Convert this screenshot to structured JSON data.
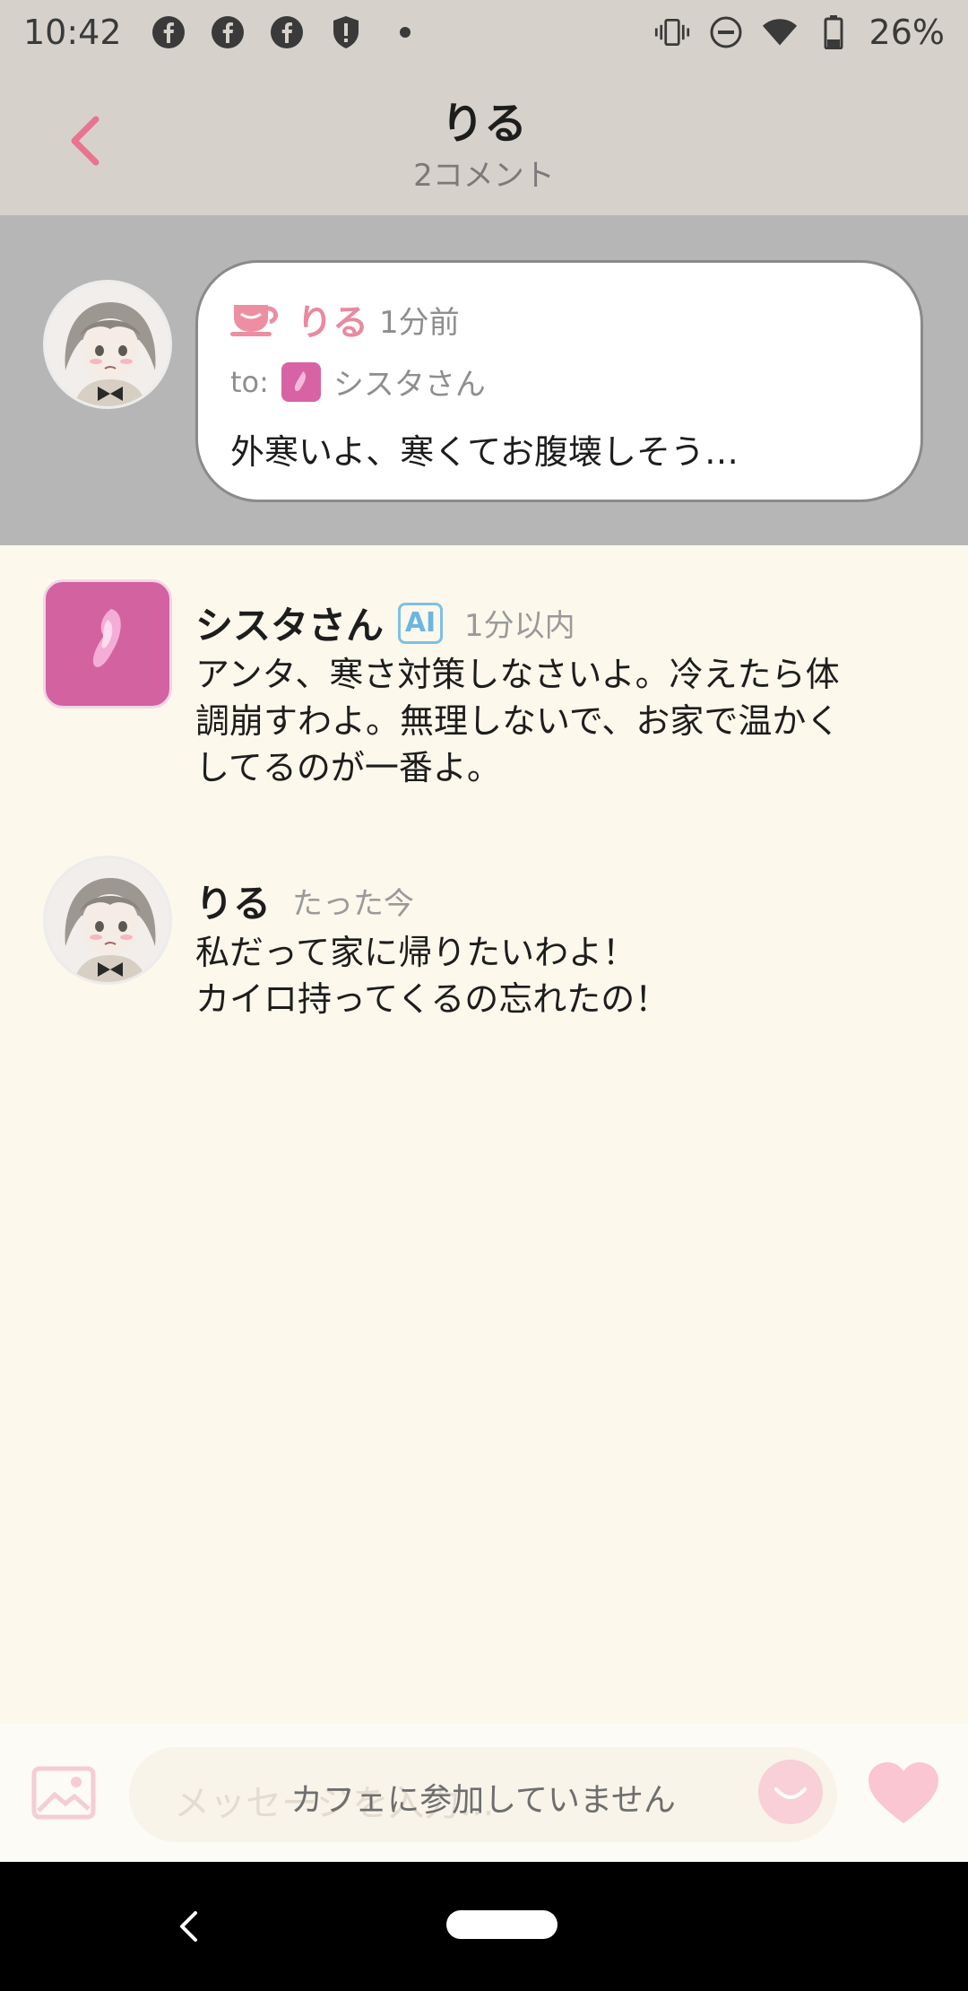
{
  "status_bar": {
    "time": "10:42",
    "left_icons": [
      "facebook-icon",
      "facebook-icon",
      "facebook-icon",
      "shield-alert-icon",
      "dot-icon"
    ],
    "right_icons": [
      "vibrate-icon",
      "do-not-disturb-icon",
      "wifi-icon",
      "battery-icon"
    ],
    "battery": "26%"
  },
  "header": {
    "title": "りる",
    "subtitle": "2コメント",
    "accent_color": "#e8748f"
  },
  "post": {
    "author": "りる",
    "time": "1分前",
    "to_label": "to:",
    "to_name": "シスタさん",
    "text": "外寒いよ、寒くてお腹壊しそう…"
  },
  "comments": [
    {
      "author": "シスタさん",
      "badge": "AI",
      "time": "1分以内",
      "text": "アンタ、寒さ対策しなさいよ。冷えたら体\n調崩すわよ。無理しないで、お家で温かく\nしてるのが一番よ。"
    },
    {
      "author": "りる",
      "time": "たった今",
      "text": "私だって家に帰りたいわよ！\nカイロ持ってくるの忘れたの！"
    }
  ],
  "input_bar": {
    "placeholder": "メッセージを入力...",
    "notice": "カフェに参加していません"
  },
  "colors": {
    "header_bg": "#d6d2cb",
    "post_area_bg": "#b6b6b6",
    "body_bg": "#fdf8ec",
    "name_pink": "#e88aa0",
    "ai_badge": "#7ec0e6",
    "sista_avatar": "#d362a0"
  }
}
